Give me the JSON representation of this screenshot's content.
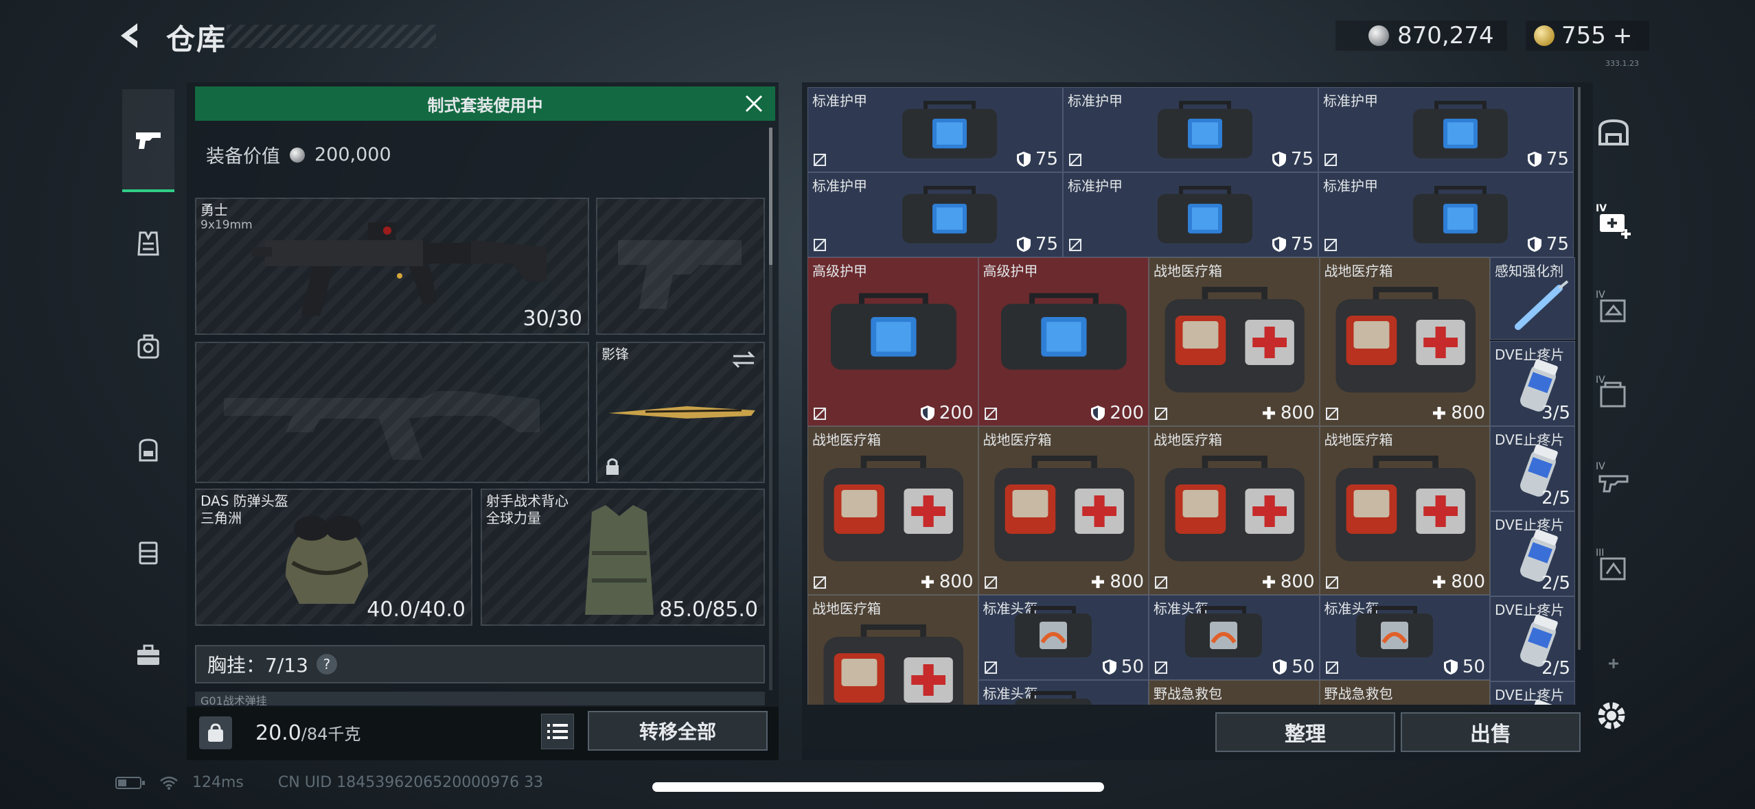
{
  "header": {
    "title": "仓库",
    "currency_silver": "870,274",
    "currency_gold": "755",
    "currency_gold_add": "+",
    "version": "333.1.23"
  },
  "left_nav": {
    "items": [
      {
        "icon": "pistol-icon",
        "active": true
      },
      {
        "icon": "vest-icon"
      },
      {
        "icon": "helmet-bag-icon"
      },
      {
        "icon": "backpack-icon"
      },
      {
        "icon": "case-icon"
      },
      {
        "icon": "toolbox-icon"
      }
    ]
  },
  "loadout": {
    "banner": "制式套装使用中",
    "value_label": "装备价值",
    "value": "200,000",
    "primary": {
      "name": "勇士",
      "caliber": "9x19mm",
      "ammo": "30/30"
    },
    "knife": {
      "name": "影锋"
    },
    "helmet": {
      "name": "DAS 防弹头盔",
      "faction": "三角洲",
      "durability": "40.0/40.0"
    },
    "armor": {
      "name": "射手战术背心",
      "faction": "全球力量",
      "durability": "85.0/85.0"
    },
    "chest_rig": {
      "label": "胸挂：7/13",
      "help": "?"
    },
    "chest_under": "G01战术弹挂",
    "weight": "20.0",
    "weight_cap": "/84千克",
    "kg": "KG",
    "transfer_all": "转移全部"
  },
  "storage": {
    "cells": [
      {
        "name": "标准护甲",
        "value": "75",
        "type": "armor-bag",
        "bg": "blue",
        "icon": "shield-icon"
      },
      {
        "name": "标准护甲",
        "value": "75",
        "type": "armor-bag",
        "bg": "blue",
        "icon": "shield-icon"
      },
      {
        "name": "标准护甲",
        "value": "75",
        "type": "armor-bag",
        "bg": "blue",
        "icon": "shield-icon"
      },
      {
        "name": "标准护甲",
        "value": "75",
        "type": "armor-bag",
        "bg": "blue",
        "icon": "shield-icon"
      },
      {
        "name": "标准护甲",
        "value": "75",
        "type": "armor-bag",
        "bg": "blue",
        "icon": "shield-icon"
      },
      {
        "name": "标准护甲",
        "value": "75",
        "type": "armor-bag",
        "bg": "blue",
        "icon": "shield-icon"
      },
      {
        "name": "高级护甲",
        "value": "200",
        "type": "big-armor-bag",
        "bg": "red",
        "icon": "shield-icon"
      },
      {
        "name": "高级护甲",
        "value": "200",
        "type": "big-armor-bag",
        "bg": "red",
        "icon": "shield-icon"
      },
      {
        "name": "战地医疗箱",
        "value": "800",
        "type": "medkit",
        "bg": "brown",
        "icon": "plus-icon"
      },
      {
        "name": "战地医疗箱",
        "value": "800",
        "type": "medkit",
        "bg": "brown",
        "icon": "plus-icon"
      },
      {
        "name": "感知强化剂",
        "value": "",
        "type": "syringe",
        "bg": "blue",
        "icon": ""
      },
      {
        "name": "DVE止疼片",
        "value": "3/5",
        "type": "pills",
        "bg": "blue",
        "icon": ""
      },
      {
        "name": "战地医疗箱",
        "value": "800",
        "type": "medkit",
        "bg": "brown",
        "icon": "plus-icon"
      },
      {
        "name": "战地医疗箱",
        "value": "800",
        "type": "medkit",
        "bg": "brown",
        "icon": "plus-icon"
      },
      {
        "name": "战地医疗箱",
        "value": "800",
        "type": "medkit",
        "bg": "brown",
        "icon": "plus-icon"
      },
      {
        "name": "战地医疗箱",
        "value": "800",
        "type": "medkit",
        "bg": "brown",
        "icon": "plus-icon"
      },
      {
        "name": "DVE止疼片",
        "value": "2/5",
        "type": "pills",
        "bg": "blue",
        "icon": ""
      },
      {
        "name": "DVE止疼片",
        "value": "2/5",
        "type": "pills",
        "bg": "blue",
        "icon": ""
      },
      {
        "name": "战地医疗箱",
        "value": "",
        "type": "medkit",
        "bg": "brown",
        "icon": ""
      },
      {
        "name": "标准头盔",
        "value": "50",
        "type": "helmet-bag",
        "bg": "blue",
        "icon": "shield-icon"
      },
      {
        "name": "标准头盔",
        "value": "50",
        "type": "helmet-bag",
        "bg": "blue",
        "icon": "shield-icon"
      },
      {
        "name": "标准头盔",
        "value": "50",
        "type": "helmet-bag",
        "bg": "blue",
        "icon": "shield-icon"
      },
      {
        "name": "DVE止疼片",
        "value": "2/5",
        "type": "pills",
        "bg": "blue",
        "icon": ""
      },
      {
        "name": "标准头盔",
        "value": "",
        "type": "helmet-bag",
        "bg": "blue",
        "icon": ""
      },
      {
        "name": "野战急救包",
        "value": "",
        "type": "firstaid",
        "bg": "brown",
        "icon": ""
      },
      {
        "name": "野战急救包",
        "value": "",
        "type": "firstaid",
        "bg": "brown",
        "icon": ""
      },
      {
        "name": "DVE止疼片",
        "value": "",
        "type": "pills",
        "bg": "blue",
        "icon": ""
      }
    ],
    "sort_label": "整理",
    "sell_label": "出售"
  },
  "right_nav": {
    "items": [
      {
        "icon": "all-items-icon",
        "tier": ""
      },
      {
        "icon": "add-medkit-icon",
        "tier": "IV"
      },
      {
        "icon": "armor-filter-icon",
        "tier": "IV"
      },
      {
        "icon": "ammo-filter-icon",
        "tier": "IV"
      },
      {
        "icon": "weapon-filter-icon",
        "tier": "IV"
      },
      {
        "icon": "helmet-filter-icon",
        "tier": "III"
      },
      {
        "icon": "more-icon",
        "tier": ""
      }
    ]
  },
  "status_bar": {
    "ping": "124ms",
    "uid": "CN UID 1845396206520000976 33"
  }
}
